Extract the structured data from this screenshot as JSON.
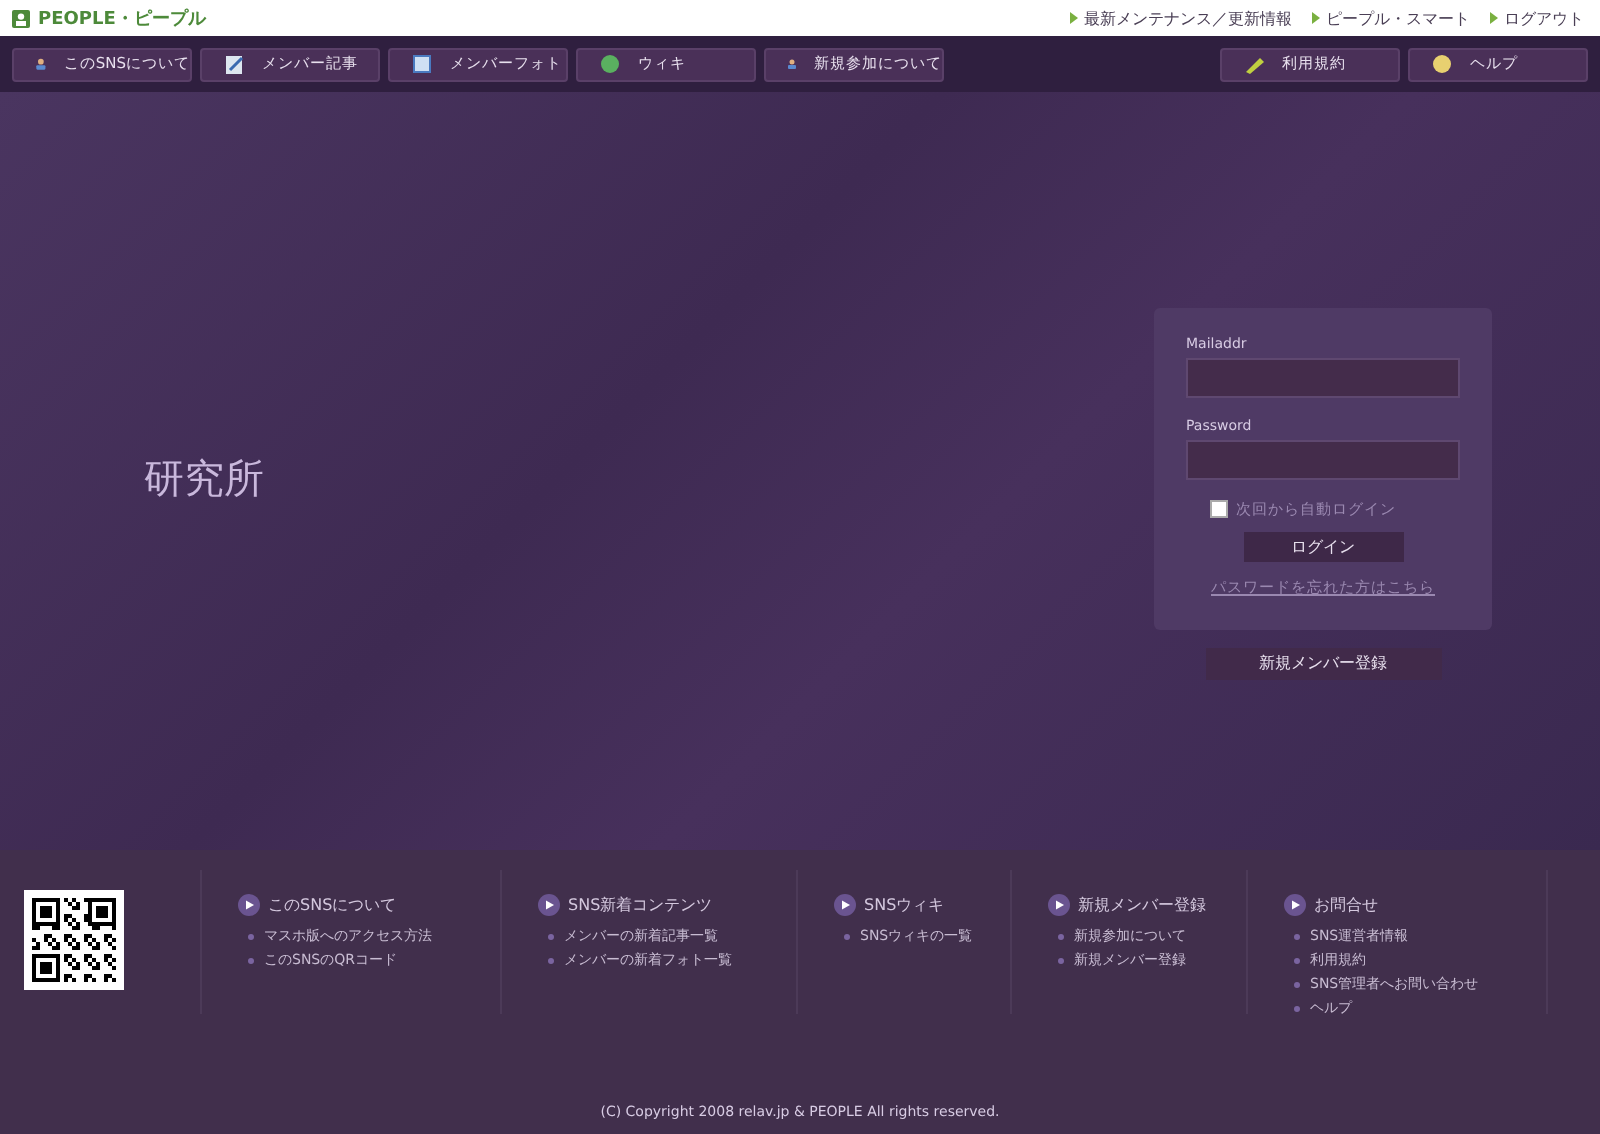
{
  "header": {
    "logo": "PEOPLE・ピープル",
    "links": [
      "最新メンテナンス／更新情報",
      "ピープル・スマート",
      "ログアウト"
    ]
  },
  "nav": {
    "left": [
      "このSNSについて",
      "メンバー記事",
      "メンバーフォト",
      "ウィキ",
      "新規参加について"
    ],
    "right": [
      "利用規約",
      "ヘルプ"
    ]
  },
  "site_title": "研究所",
  "login": {
    "mail_label": "Mailaddr",
    "password_label": "Password",
    "remember": {
      "label": "次回から自動ログイン",
      "checked": false
    },
    "button": "ログイン",
    "forgot": "パスワードを忘れた方はこちら"
  },
  "register_button": "新規メンバー登録",
  "footer": {
    "columns": [
      {
        "title": "このSNSについて",
        "items": [
          "マスホ版へのアクセス方法",
          "このSNSのQRコード"
        ]
      },
      {
        "title": "SNS新着コンテンツ",
        "items": [
          "メンバーの新着記事一覧",
          "メンバーの新着フォト一覧"
        ]
      },
      {
        "title": "SNSウィキ",
        "items": [
          "SNSウィキの一覧"
        ]
      },
      {
        "title": "新規メンバー登録",
        "items": [
          "新規参加について",
          "新規メンバー登録"
        ]
      },
      {
        "title": "お問合せ",
        "items": [
          "SNS運営者情報",
          "利用規約",
          "SNS管理者へお問い合わせ",
          "ヘルプ"
        ]
      }
    ],
    "copyright": "(C) Copyright 2008 relav.jp & PEOPLE All rights reserved."
  }
}
